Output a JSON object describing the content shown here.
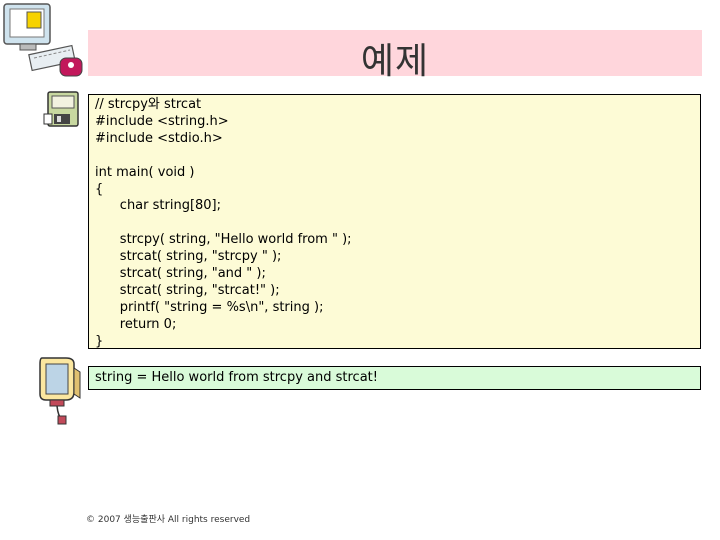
{
  "slide": {
    "title": "예제",
    "code_lines": [
      "// strcpy와 strcat",
      "#include <string.h>",
      "#include <stdio.h>",
      "",
      "int main( void )",
      "{",
      "      char string[80];",
      "",
      "      strcpy( string, \"Hello world from \" );",
      "      strcat( string, \"strcpy \" );",
      "      strcat( string, \"and \" );",
      "      strcat( string, \"strcat!\" );",
      "      printf( \"string = %s\\n\", string );",
      "      return 0;",
      "}"
    ],
    "output": "string = Hello world from strcpy and strcat!",
    "footer": "© 2007 생능출판사  All rights reserved"
  },
  "icons": {
    "computer": "computer-icon",
    "floppy": "floppy-disk-icon",
    "monitor": "monitor-icon"
  },
  "colors": {
    "title_banner": "#ffd6dc",
    "code_background": "#fdfbd6",
    "output_background": "#d9fbd9"
  }
}
